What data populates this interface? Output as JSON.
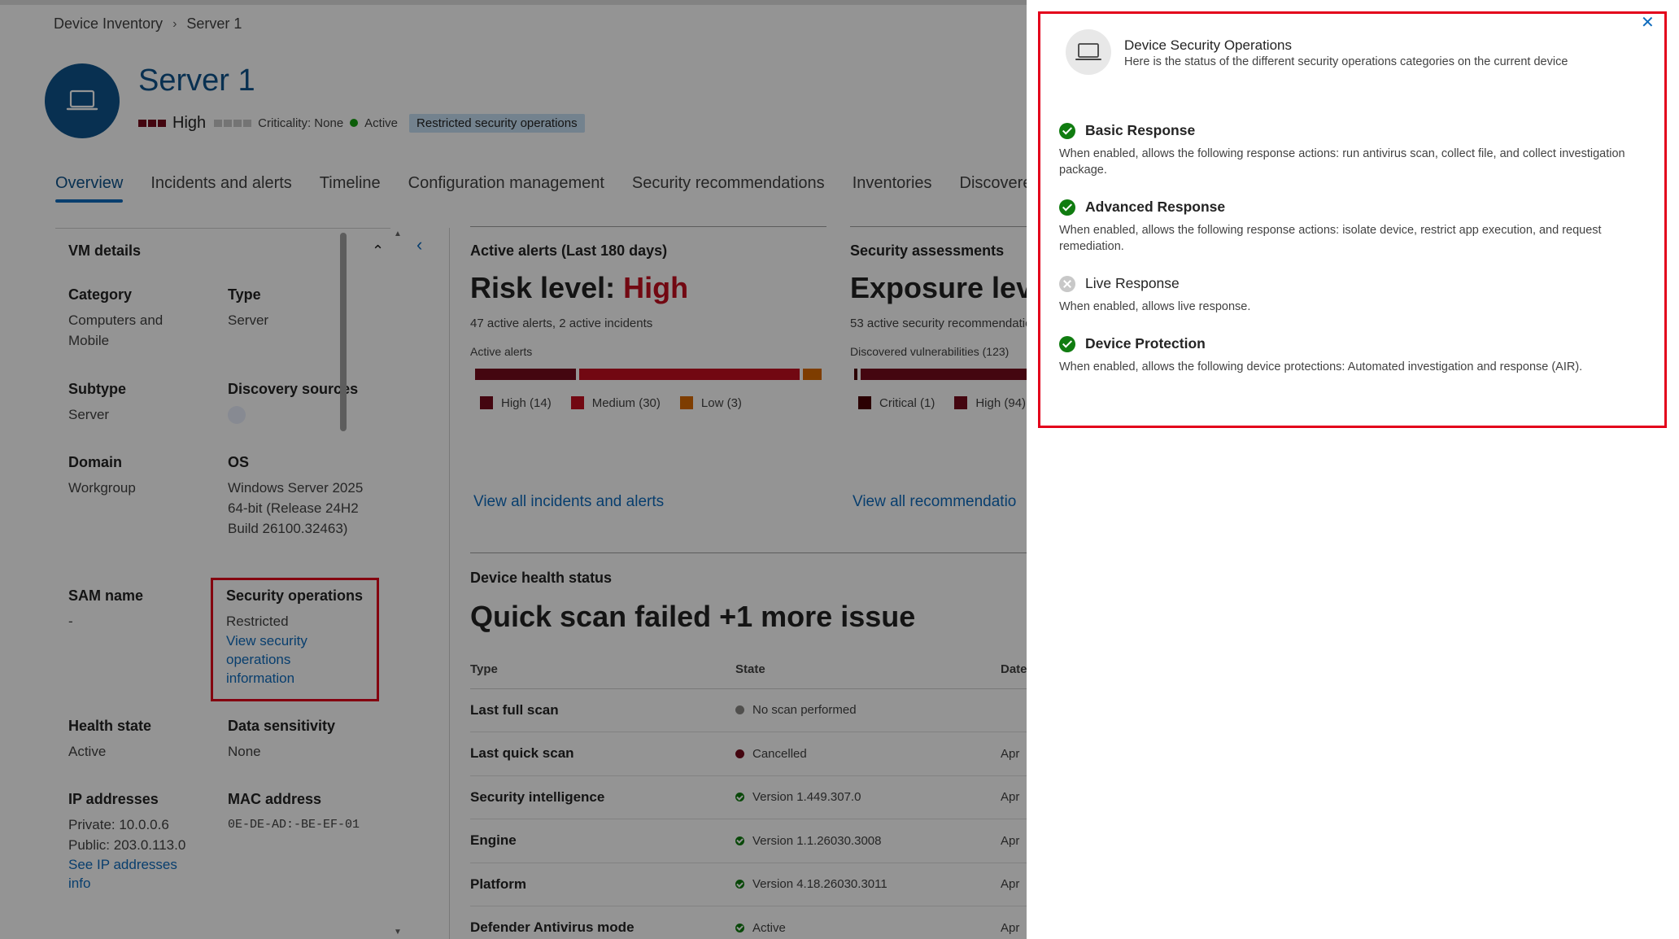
{
  "breadcrumb": {
    "root": "Device Inventory",
    "current": "Server 1"
  },
  "device": {
    "name": "Server 1",
    "risk": "High",
    "criticality": "Criticality: None",
    "status": "Active",
    "restricted_pill": "Restricted security operations"
  },
  "tabs": [
    {
      "label": "Overview"
    },
    {
      "label": "Incidents and alerts"
    },
    {
      "label": "Timeline"
    },
    {
      "label": "Configuration management"
    },
    {
      "label": "Security recommendations"
    },
    {
      "label": "Inventories"
    },
    {
      "label": "Discovere"
    }
  ],
  "vm": {
    "header": "VM details",
    "category": {
      "label": "Category",
      "value": "Computers and Mobile"
    },
    "type": {
      "label": "Type",
      "value": "Server"
    },
    "subtype": {
      "label": "Subtype",
      "value": "Server"
    },
    "discovery": {
      "label": "Discovery sources"
    },
    "domain": {
      "label": "Domain",
      "value": "Workgroup"
    },
    "os": {
      "label": "OS",
      "value": "Windows Server 2025 64-bit (Release 24H2 Build 26100.32463)"
    },
    "sam": {
      "label": "SAM name",
      "value": "-"
    },
    "secops": {
      "label": "Security operations",
      "value": "Restricted",
      "link": "View security operations information"
    },
    "health": {
      "label": "Health state",
      "value": "Active"
    },
    "sensitivity": {
      "label": "Data sensitivity",
      "value": "None"
    },
    "ip": {
      "label": "IP addresses",
      "private": "Private: 10.0.0.6",
      "public": "Public: 203.0.113.0",
      "link": "See IP addresses info"
    },
    "mac": {
      "label": "MAC address",
      "value": "0E-DE-AD:-BE-EF-01"
    }
  },
  "alerts": {
    "title": "Active alerts (Last 180 days)",
    "risk_prefix": "Risk level: ",
    "risk_value": "High",
    "summary": "47 active alerts, 2 active incidents",
    "bar_label": "Active alerts",
    "legend": [
      {
        "label": "High (14)",
        "value": 14,
        "color": "#750b1c"
      },
      {
        "label": "Medium (30)",
        "value": 30,
        "color": "#c50f1f"
      },
      {
        "label": "Low (3)",
        "value": 3,
        "color": "#da6a00"
      }
    ],
    "link": "View all incidents and alerts"
  },
  "assessments": {
    "title": "Security assessments",
    "big": "Exposure leve",
    "summary": "53 active security recommendatio",
    "bar_label": "Discovered vulnerabilities (123)",
    "legend": [
      {
        "label": "Critical (1)",
        "value": 1,
        "color": "#4a0004"
      },
      {
        "label": "High (94)",
        "value": 94,
        "color": "#750b1c"
      }
    ],
    "link": "View all recommendatio"
  },
  "health": {
    "title": "Device health status",
    "big": "Quick scan failed +1 more issue",
    "columns": [
      "Type",
      "State",
      "Date"
    ],
    "rows": [
      {
        "type": "Last full scan",
        "state": "No scan performed",
        "date": "",
        "status": "gray"
      },
      {
        "type": "Last quick scan",
        "state": "Cancelled",
        "date": "Apr",
        "status": "red"
      },
      {
        "type": "Security intelligence",
        "state": "Version 1.449.307.0",
        "date": "Apr",
        "status": "green"
      },
      {
        "type": "Engine",
        "state": "Version 1.1.26030.3008",
        "date": "Apr",
        "status": "green"
      },
      {
        "type": "Platform",
        "state": "Version 4.18.26030.3011",
        "date": "Apr",
        "status": "green"
      },
      {
        "type": "Defender Antivirus mode",
        "state": "Active",
        "date": "Apr",
        "status": "green"
      }
    ]
  },
  "panel": {
    "title": "Device Security Operations",
    "subtitle": "Here is the status of the different security operations categories on the current device",
    "categories": [
      {
        "name": "Basic Response",
        "enabled": true,
        "desc": "When enabled, allows the following response actions: run antivirus scan, collect file, and collect investigation package."
      },
      {
        "name": "Advanced Response",
        "enabled": true,
        "desc": "When enabled, allows the following response actions: isolate device, restrict app execution, and request remediation."
      },
      {
        "name": "Live Response",
        "enabled": false,
        "desc": "When enabled, allows live response."
      },
      {
        "name": "Device Protection",
        "enabled": true,
        "desc": "When enabled, allows the following device protections: Automated investigation and response (AIR)."
      }
    ]
  },
  "colors": {
    "brand": "#0f548c",
    "link": "#0f6cbd",
    "high": "#750b1c",
    "medium": "#c50f1f",
    "low": "#da6a00",
    "ok": "#107c10",
    "callout": "#e3001b"
  },
  "icons": [
    "chevron-right-icon",
    "laptop-icon",
    "chevron-up-icon",
    "chevron-left-icon",
    "discovery-source-icon",
    "close-icon",
    "check-circle-icon",
    "dismiss-circle-icon"
  ]
}
